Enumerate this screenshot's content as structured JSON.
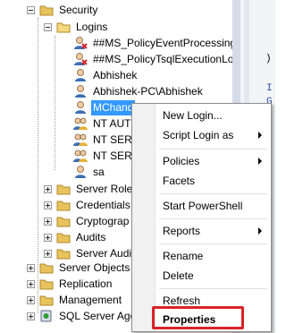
{
  "tree": {
    "security": "Security",
    "logins": "Logins",
    "login_items": [
      "##MS_PolicyEventProcessing",
      "##MS_PolicyTsqlExecutionLo",
      "Abhishek",
      "Abhishek-PC\\Abhishek",
      "MChand",
      "NT AUTH",
      "NT SERV",
      "NT SERV",
      "sa"
    ],
    "security_children": [
      "Server Roles",
      "Credentials",
      "Cryptograp",
      "Audits",
      "Server Audit"
    ],
    "server_nodes": [
      "Server Objects",
      "Replication",
      "Management",
      "SQL Server Age"
    ]
  },
  "editor": {
    "lines": [
      ")",
      "I",
      "G"
    ]
  },
  "context_menu": {
    "items": [
      {
        "label": "New Login...",
        "submenu": false
      },
      {
        "label": "Script Login as",
        "submenu": true
      },
      {
        "label": "Policies",
        "submenu": true
      },
      {
        "label": "Facets",
        "submenu": false
      },
      {
        "label": "Start PowerShell",
        "submenu": false
      },
      {
        "label": "Reports",
        "submenu": true
      },
      {
        "label": "Rename",
        "submenu": false
      },
      {
        "label": "Delete",
        "submenu": false
      },
      {
        "label": "Refresh",
        "submenu": false
      },
      {
        "label": "Properties",
        "submenu": false
      }
    ],
    "highlighted_item": "Properties",
    "highlight_color": "#d9232a"
  },
  "colors": {
    "selection": "#3399ff",
    "folder": "#e8c35c",
    "user_icon": "#3d6db5"
  }
}
